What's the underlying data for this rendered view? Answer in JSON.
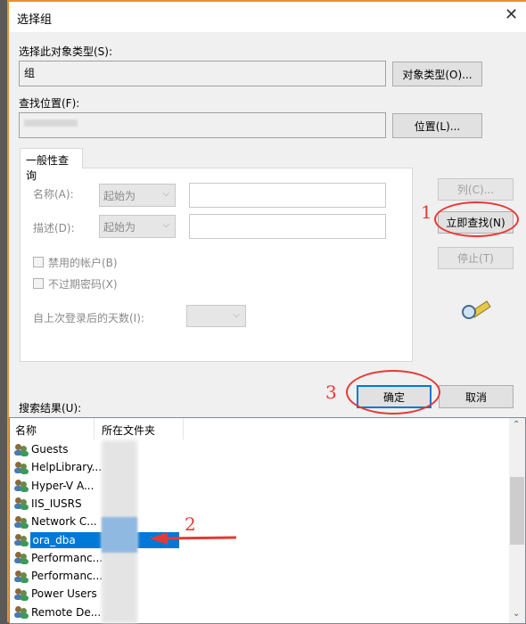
{
  "title": "选择组",
  "object_type": {
    "label": "选择此对象类型(S):",
    "value": "组",
    "button": "对象类型(O)..."
  },
  "location": {
    "label": "查找位置(F):",
    "value": "",
    "button": "位置(L)..."
  },
  "tab": "一般性查询",
  "query": {
    "name_label": "名称(A):",
    "name_mode": "起始为",
    "desc_label": "描述(D):",
    "desc_mode": "起始为",
    "disabled_accounts": "禁用的帐户(B)",
    "non_expiring_pwd": "不过期密码(X)",
    "days_since_login": "自上次登录后的天数(I):"
  },
  "side_buttons": {
    "columns": "列(C)...",
    "find_now": "立即查找(N)",
    "stop": "停止(T)"
  },
  "ok": "确定",
  "cancel": "取消",
  "results_label": "搜索结果(U):",
  "columns": [
    "名称",
    "所在文件夹"
  ],
  "rows": [
    "Guests",
    "HelpLibrary...",
    "Hyper-V A...",
    "IIS_IUSRS",
    "Network C...",
    "ora_dba",
    "Performanc...",
    "Performanc...",
    "Power Users",
    "Remote De..."
  ],
  "selected_row": "ora_dba",
  "annotations": [
    "1",
    "2",
    "3"
  ],
  "colors": {
    "selection": "#0078d7",
    "annotation": "#e53935",
    "accent_border": "#e8912c"
  }
}
